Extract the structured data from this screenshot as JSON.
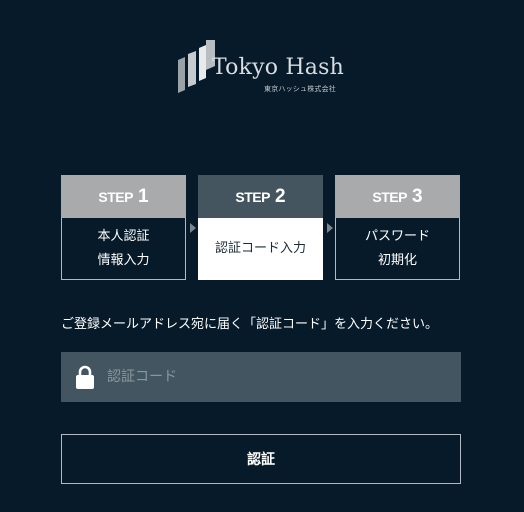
{
  "logo": {
    "name": "Tokyo Hash",
    "subtitle": "東京ハッシュ株式会社",
    "icon": "tokyo-hash-logo-mark"
  },
  "steps": [
    {
      "word": "STEP",
      "number": "1",
      "label": "本人認証\n情報入力",
      "state": "inactive"
    },
    {
      "word": "STEP",
      "number": "2",
      "label": "認証コード入力",
      "state": "active"
    },
    {
      "word": "STEP",
      "number": "3",
      "label": "パスワード\n初期化",
      "state": "inactive"
    }
  ],
  "instruction": "ご登録メールアドレス宛に届く「認証コード」を入力ください。",
  "code_field": {
    "placeholder": "認証コード",
    "value": "",
    "icon": "lock-icon"
  },
  "submit": {
    "label": "認証"
  },
  "colors": {
    "background": "#071a29",
    "step_inactive": "#a8aaab",
    "step_active": "#44555f",
    "input_background": "#435560",
    "border": "#b3b9be"
  }
}
